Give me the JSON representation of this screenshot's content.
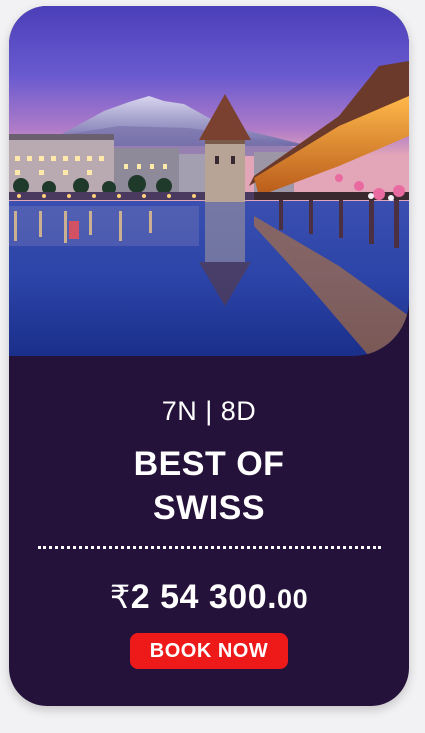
{
  "package": {
    "duration": "7N | 8D",
    "title_line1": "BEST OF",
    "title_line2": "SWISS",
    "price_currency": "₹",
    "price_amount": "2 54 300.",
    "price_decimals": "00",
    "book_label": "BOOK NOW"
  },
  "colors": {
    "card_background": "#25123a",
    "button": "#ee1a1a",
    "text": "#ffffff"
  }
}
